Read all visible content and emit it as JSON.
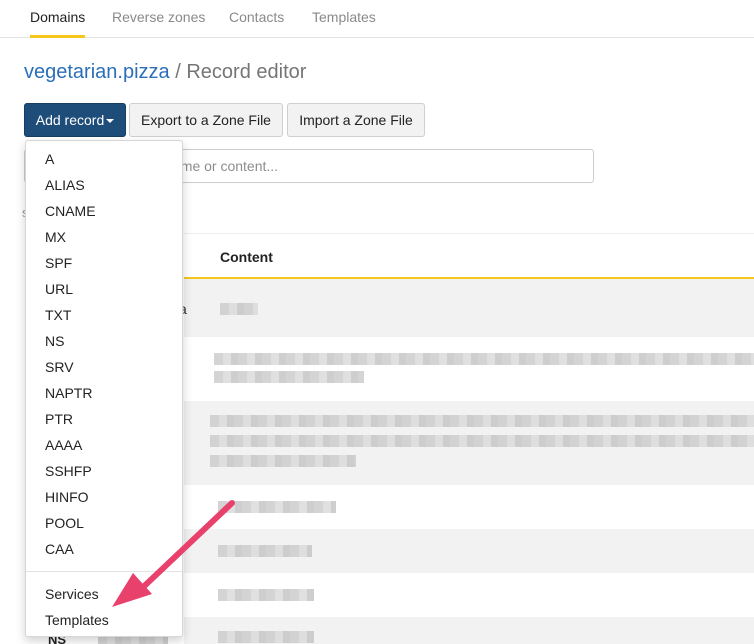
{
  "nav": {
    "tabs": [
      {
        "label": "Domains",
        "active": true
      },
      {
        "label": "Reverse zones",
        "active": false
      },
      {
        "label": "Contacts",
        "active": false
      },
      {
        "label": "Templates",
        "active": false
      }
    ]
  },
  "heading": {
    "domain": "vegetarian.pizza",
    "separator": "/",
    "section": "Record editor"
  },
  "toolbar": {
    "add_record_label": "Add record",
    "export_label": "Export to a Zone File",
    "import_label": "Import a Zone File"
  },
  "search": {
    "placeholder_visible_fragment": "ame or content..."
  },
  "table": {
    "content_header": "Content",
    "first_row_name_fragment": "za",
    "last_row_type_fragment": "NS"
  },
  "dropdown": {
    "record_types": [
      "A",
      "ALIAS",
      "CNAME",
      "MX",
      "SPF",
      "URL",
      "TXT",
      "NS",
      "SRV",
      "NAPTR",
      "PTR",
      "AAAA",
      "SSHFP",
      "HINFO",
      "POOL",
      "CAA"
    ],
    "extra_items": [
      "Services",
      "Templates"
    ]
  },
  "colors": {
    "accent_yellow": "#f5c71a",
    "primary_button": "#1f4d7a",
    "link_blue": "#2a6fb8",
    "annotation_arrow": "#e8416b"
  }
}
